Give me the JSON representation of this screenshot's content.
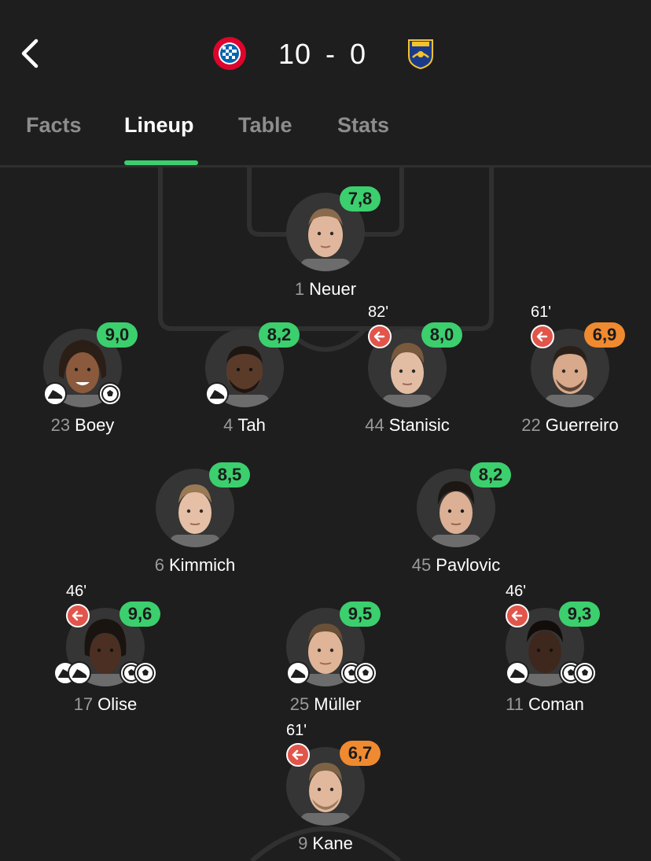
{
  "header": {
    "home_crest_icon": "fc-bayern-munchen-crest",
    "away_crest_icon": "opponent-club-crest",
    "home_score": "10",
    "separator": "-",
    "away_score": "0"
  },
  "tabs": [
    {
      "label": "Facts",
      "active": false
    },
    {
      "label": "Lineup",
      "active": true
    },
    {
      "label": "Table",
      "active": false
    },
    {
      "label": "Stats",
      "active": false
    }
  ],
  "colors": {
    "background": "#1e1e1e",
    "accent_green": "#3ccf6e",
    "rating_orange": "#f08a30",
    "sub_red": "#e1554b"
  },
  "players": [
    {
      "number": "1",
      "name": "Neuer",
      "rating": "7,8",
      "rating_color": "green"
    },
    {
      "number": "23",
      "name": "Boey",
      "rating": "9,0",
      "rating_color": "green",
      "badges": [
        "boot-icon",
        "ball-icon"
      ]
    },
    {
      "number": "4",
      "name": "Tah",
      "rating": "8,2",
      "rating_color": "green",
      "badges": [
        "boot-icon"
      ]
    },
    {
      "number": "44",
      "name": "Stanisic",
      "rating": "8,0",
      "rating_color": "green",
      "sub_minute": "82'"
    },
    {
      "number": "22",
      "name": "Guerreiro",
      "rating": "6,9",
      "rating_color": "orange",
      "sub_minute": "61'"
    },
    {
      "number": "6",
      "name": "Kimmich",
      "rating": "8,5",
      "rating_color": "green"
    },
    {
      "number": "45",
      "name": "Pavlovic",
      "rating": "8,2",
      "rating_color": "green"
    },
    {
      "number": "17",
      "name": "Olise",
      "rating": "9,6",
      "rating_color": "green",
      "sub_minute": "46'",
      "badges": [
        "two-boots-icon",
        "two-balls-icon"
      ]
    },
    {
      "number": "25",
      "name": "Müller",
      "rating": "9,5",
      "rating_color": "green",
      "badges": [
        "boot-icon",
        "two-balls-icon"
      ]
    },
    {
      "number": "11",
      "name": "Coman",
      "rating": "9,3",
      "rating_color": "green",
      "sub_minute": "46'",
      "badges": [
        "boot-icon",
        "two-balls-icon"
      ]
    },
    {
      "number": "9",
      "name": "Kane",
      "rating": "6,7",
      "rating_color": "orange",
      "sub_minute": "61'"
    }
  ]
}
